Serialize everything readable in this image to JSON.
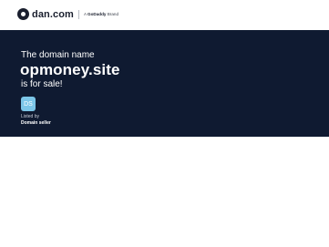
{
  "header": {
    "logo_text": "dan.com",
    "brand_prefix": "A",
    "brand_name": "GoDaddy",
    "brand_suffix": "Brand"
  },
  "hero": {
    "intro": "The domain name",
    "domain": "opmoney.site",
    "sale_text": "is for sale!",
    "seller_initials": "DS",
    "listed_by": "Listed by",
    "seller_name": "Domain seller"
  },
  "colors": {
    "hero_bg": "#0f1a31",
    "avatar_bg": "#7cc6e8"
  }
}
